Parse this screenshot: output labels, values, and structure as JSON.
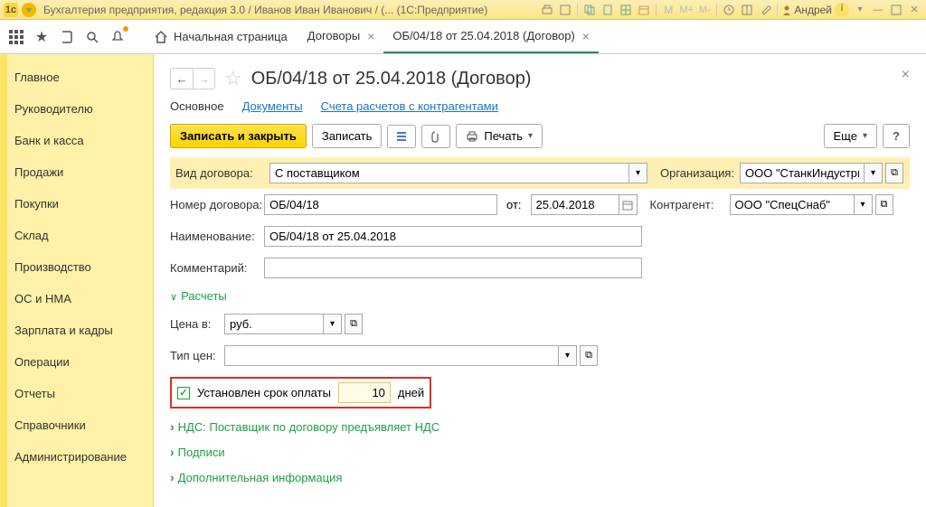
{
  "titlebar": {
    "title": "Бухгалтерия предприятия, редакция 3.0 / Иванов Иван Иванович / (...  (1С:Предприятие)",
    "user": "Андрей",
    "m_icons": [
      "M",
      "M+",
      "M-"
    ]
  },
  "toolbar": {
    "home": "Начальная страница",
    "tabs": [
      {
        "label": "Договоры",
        "active": false
      },
      {
        "label": "ОБ/04/18 от 25.04.2018 (Договор)",
        "active": true
      }
    ]
  },
  "sidebar": {
    "items": [
      "Главное",
      "Руководителю",
      "Банк и касса",
      "Продажи",
      "Покупки",
      "Склад",
      "Производство",
      "ОС и НМА",
      "Зарплата и кадры",
      "Операции",
      "Отчеты",
      "Справочники",
      "Администрирование"
    ]
  },
  "page": {
    "title": "ОБ/04/18 от 25.04.2018 (Договор)",
    "subnav": {
      "main": "Основное",
      "documents": "Документы",
      "accounts": "Счета расчетов с контрагентами"
    },
    "actions": {
      "save_close": "Записать и закрыть",
      "save": "Записать",
      "print": "Печать",
      "more": "Еще"
    },
    "fields": {
      "vid_label": "Вид договора:",
      "vid_value": "С поставщиком",
      "org_label": "Организация:",
      "org_value": "ООО \"СтанкИндустриал\"",
      "nomer_label": "Номер договора:",
      "nomer_value": "ОБ/04/18",
      "ot_label": "от:",
      "ot_value": "25.04.2018",
      "kontr_label": "Контрагент:",
      "kontr_value": "ООО \"СпецСнаб\"",
      "naimen_label": "Наименование:",
      "naimen_value": "ОБ/04/18 от 25.04.2018",
      "komment_label": "Комментарий:",
      "komment_value": "",
      "raschety": "Расчеты",
      "cena_label": "Цена в:",
      "cena_value": "руб.",
      "tip_label": "Тип цен:",
      "tip_value": "",
      "srok_label": "Установлен срок оплаты",
      "srok_value": "10",
      "srok_unit": "дней",
      "nds": "НДС: Поставщик по договору предъявляет НДС",
      "podpisi": "Подписи",
      "dopinfo": "Дополнительная информация"
    }
  }
}
